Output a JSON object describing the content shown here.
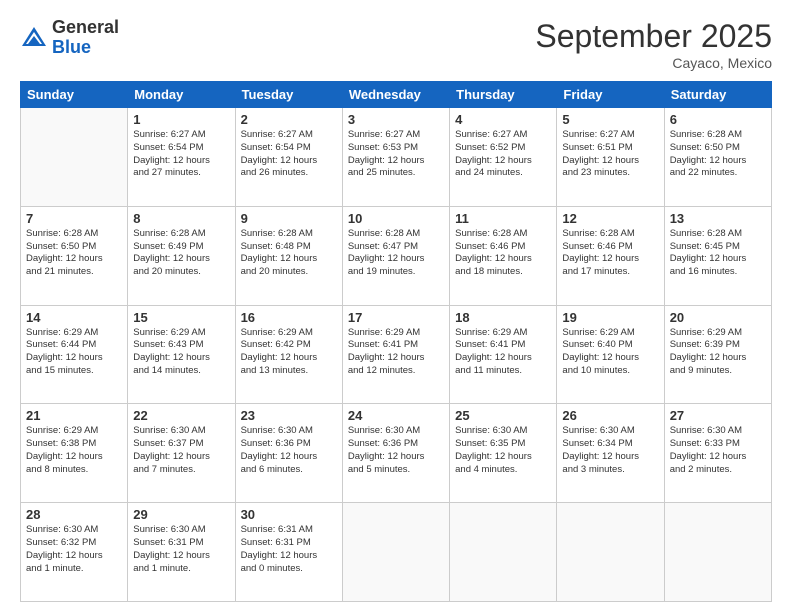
{
  "logo": {
    "general": "General",
    "blue": "Blue"
  },
  "header": {
    "month": "September 2025",
    "location": "Cayaco, Mexico"
  },
  "weekdays": [
    "Sunday",
    "Monday",
    "Tuesday",
    "Wednesday",
    "Thursday",
    "Friday",
    "Saturday"
  ],
  "weeks": [
    [
      {
        "day": "",
        "info": ""
      },
      {
        "day": "1",
        "info": "Sunrise: 6:27 AM\nSunset: 6:54 PM\nDaylight: 12 hours\nand 27 minutes."
      },
      {
        "day": "2",
        "info": "Sunrise: 6:27 AM\nSunset: 6:54 PM\nDaylight: 12 hours\nand 26 minutes."
      },
      {
        "day": "3",
        "info": "Sunrise: 6:27 AM\nSunset: 6:53 PM\nDaylight: 12 hours\nand 25 minutes."
      },
      {
        "day": "4",
        "info": "Sunrise: 6:27 AM\nSunset: 6:52 PM\nDaylight: 12 hours\nand 24 minutes."
      },
      {
        "day": "5",
        "info": "Sunrise: 6:27 AM\nSunset: 6:51 PM\nDaylight: 12 hours\nand 23 minutes."
      },
      {
        "day": "6",
        "info": "Sunrise: 6:28 AM\nSunset: 6:50 PM\nDaylight: 12 hours\nand 22 minutes."
      }
    ],
    [
      {
        "day": "7",
        "info": "Sunrise: 6:28 AM\nSunset: 6:50 PM\nDaylight: 12 hours\nand 21 minutes."
      },
      {
        "day": "8",
        "info": "Sunrise: 6:28 AM\nSunset: 6:49 PM\nDaylight: 12 hours\nand 20 minutes."
      },
      {
        "day": "9",
        "info": "Sunrise: 6:28 AM\nSunset: 6:48 PM\nDaylight: 12 hours\nand 20 minutes."
      },
      {
        "day": "10",
        "info": "Sunrise: 6:28 AM\nSunset: 6:47 PM\nDaylight: 12 hours\nand 19 minutes."
      },
      {
        "day": "11",
        "info": "Sunrise: 6:28 AM\nSunset: 6:46 PM\nDaylight: 12 hours\nand 18 minutes."
      },
      {
        "day": "12",
        "info": "Sunrise: 6:28 AM\nSunset: 6:46 PM\nDaylight: 12 hours\nand 17 minutes."
      },
      {
        "day": "13",
        "info": "Sunrise: 6:28 AM\nSunset: 6:45 PM\nDaylight: 12 hours\nand 16 minutes."
      }
    ],
    [
      {
        "day": "14",
        "info": "Sunrise: 6:29 AM\nSunset: 6:44 PM\nDaylight: 12 hours\nand 15 minutes."
      },
      {
        "day": "15",
        "info": "Sunrise: 6:29 AM\nSunset: 6:43 PM\nDaylight: 12 hours\nand 14 minutes."
      },
      {
        "day": "16",
        "info": "Sunrise: 6:29 AM\nSunset: 6:42 PM\nDaylight: 12 hours\nand 13 minutes."
      },
      {
        "day": "17",
        "info": "Sunrise: 6:29 AM\nSunset: 6:41 PM\nDaylight: 12 hours\nand 12 minutes."
      },
      {
        "day": "18",
        "info": "Sunrise: 6:29 AM\nSunset: 6:41 PM\nDaylight: 12 hours\nand 11 minutes."
      },
      {
        "day": "19",
        "info": "Sunrise: 6:29 AM\nSunset: 6:40 PM\nDaylight: 12 hours\nand 10 minutes."
      },
      {
        "day": "20",
        "info": "Sunrise: 6:29 AM\nSunset: 6:39 PM\nDaylight: 12 hours\nand 9 minutes."
      }
    ],
    [
      {
        "day": "21",
        "info": "Sunrise: 6:29 AM\nSunset: 6:38 PM\nDaylight: 12 hours\nand 8 minutes."
      },
      {
        "day": "22",
        "info": "Sunrise: 6:30 AM\nSunset: 6:37 PM\nDaylight: 12 hours\nand 7 minutes."
      },
      {
        "day": "23",
        "info": "Sunrise: 6:30 AM\nSunset: 6:36 PM\nDaylight: 12 hours\nand 6 minutes."
      },
      {
        "day": "24",
        "info": "Sunrise: 6:30 AM\nSunset: 6:36 PM\nDaylight: 12 hours\nand 5 minutes."
      },
      {
        "day": "25",
        "info": "Sunrise: 6:30 AM\nSunset: 6:35 PM\nDaylight: 12 hours\nand 4 minutes."
      },
      {
        "day": "26",
        "info": "Sunrise: 6:30 AM\nSunset: 6:34 PM\nDaylight: 12 hours\nand 3 minutes."
      },
      {
        "day": "27",
        "info": "Sunrise: 6:30 AM\nSunset: 6:33 PM\nDaylight: 12 hours\nand 2 minutes."
      }
    ],
    [
      {
        "day": "28",
        "info": "Sunrise: 6:30 AM\nSunset: 6:32 PM\nDaylight: 12 hours\nand 1 minute."
      },
      {
        "day": "29",
        "info": "Sunrise: 6:30 AM\nSunset: 6:31 PM\nDaylight: 12 hours\nand 1 minute."
      },
      {
        "day": "30",
        "info": "Sunrise: 6:31 AM\nSunset: 6:31 PM\nDaylight: 12 hours\nand 0 minutes."
      },
      {
        "day": "",
        "info": ""
      },
      {
        "day": "",
        "info": ""
      },
      {
        "day": "",
        "info": ""
      },
      {
        "day": "",
        "info": ""
      }
    ]
  ]
}
